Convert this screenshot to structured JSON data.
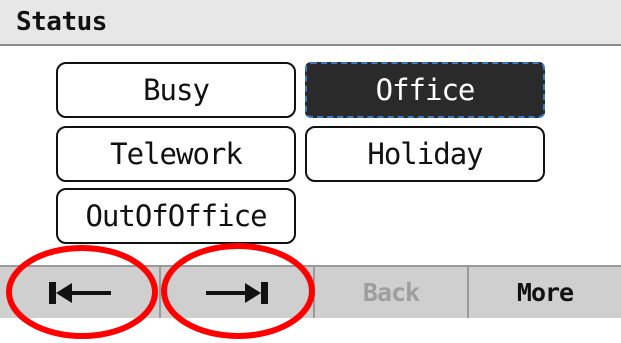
{
  "header": {
    "title": "Status"
  },
  "status_options": [
    {
      "label": "Busy",
      "selected": false
    },
    {
      "label": "Office",
      "selected": true
    },
    {
      "label": "Telework",
      "selected": false
    },
    {
      "label": "Holiday",
      "selected": false
    },
    {
      "label": "OutOfOffice",
      "selected": false
    }
  ],
  "softkeys": [
    {
      "icon": "move-to-start-icon",
      "enabled": true
    },
    {
      "icon": "move-to-end-icon",
      "enabled": true
    },
    {
      "label": "Back",
      "enabled": false
    },
    {
      "label": "More",
      "enabled": true
    }
  ],
  "annotations": {
    "circle_color": "#ff0000",
    "circled_softkeys": [
      0,
      1
    ]
  },
  "colors": {
    "selected_bg": "#2a2a2a",
    "focus_outline": "#3a78c8",
    "softkey_bar": "#cfcfcf"
  }
}
